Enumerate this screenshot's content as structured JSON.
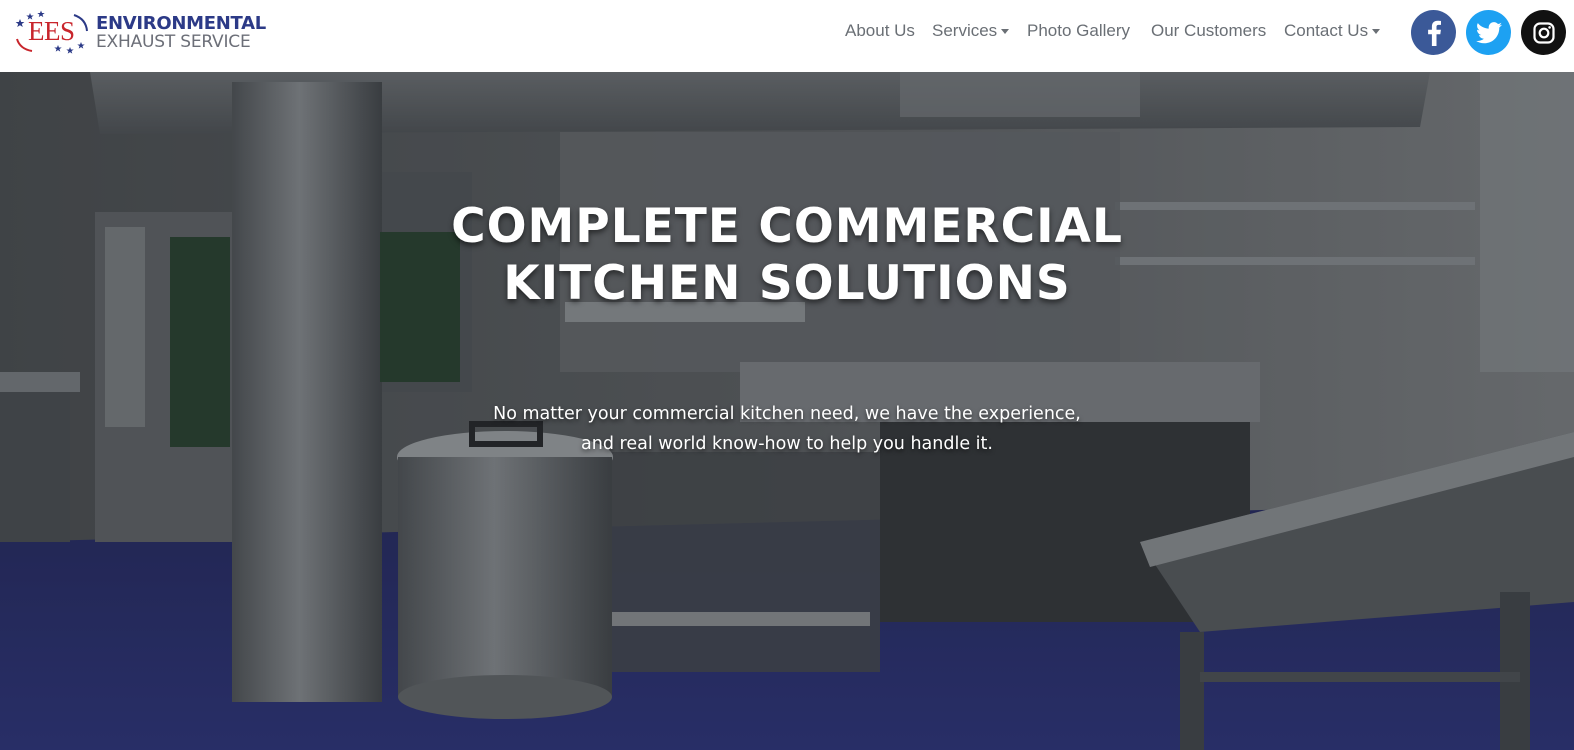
{
  "logo": {
    "mark": "EES",
    "line1": "ENVIRONMENTAL",
    "line2": "EXHAUST SERVICE",
    "colors": {
      "red": "#c8252c",
      "blue": "#2c3a87",
      "gray": "#6c6f78"
    }
  },
  "nav": {
    "items": [
      {
        "label": "About Us",
        "dropdown": false
      },
      {
        "label": "Services",
        "dropdown": true
      },
      {
        "label": "Photo Gallery",
        "dropdown": false
      },
      {
        "label": "Our Customers",
        "dropdown": false
      },
      {
        "label": "Contact Us",
        "dropdown": true
      }
    ],
    "text_color": "#6a6f75"
  },
  "social": [
    {
      "name": "facebook-icon",
      "color": "#3b5998"
    },
    {
      "name": "twitter-icon",
      "color": "#1da1f2"
    },
    {
      "name": "instagram-icon",
      "color": "#111111"
    }
  ],
  "hero": {
    "title_line1": "COMPLETE COMMERCIAL",
    "title_line2": "KITCHEN SOLUTIONS",
    "subtitle_line1": "No matter your commercial kitchen need, we have the experience,",
    "subtitle_line2": "and real world know-how to help you handle it.",
    "background": "commercial-kitchen-photo",
    "floor_color": "#2e3580"
  }
}
